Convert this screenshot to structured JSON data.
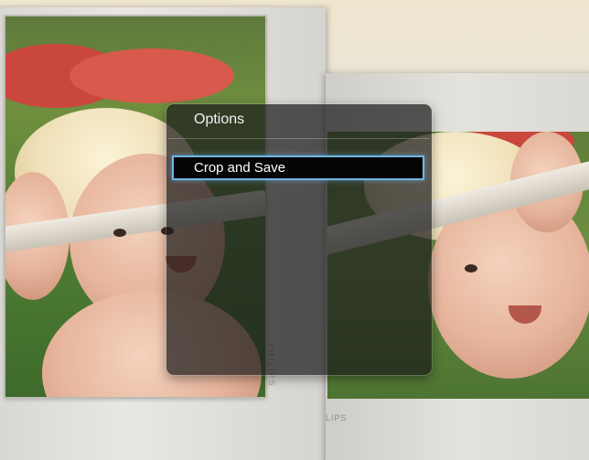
{
  "dialog": {
    "title": "Options",
    "items": [
      {
        "label": "Crop and Save",
        "selected": true
      }
    ]
  },
  "frames": {
    "left_brand": "PHILIPS",
    "right_brand": "LIPS"
  },
  "colors": {
    "dialog_bg": "#1c1c1c",
    "selection_border": "#6fb6e6",
    "text": "#ffffff"
  }
}
